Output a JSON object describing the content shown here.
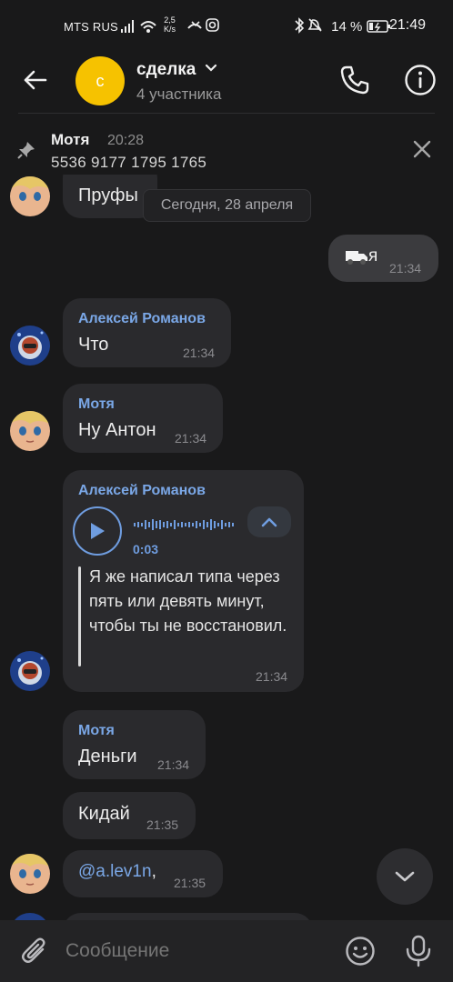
{
  "status_bar": {
    "carrier": "MTS RUS",
    "net_speed_value": "2,5",
    "net_speed_unit": "K/s",
    "battery": "14 %",
    "time": "21:49"
  },
  "header": {
    "avatar_letter": "с",
    "title": "сделка",
    "subtitle": "4 участника",
    "avatar_color": "#f6c200",
    "accent": "#7aa7e6"
  },
  "pinned": {
    "author": "Мотя",
    "time": "20:28",
    "text": "5536 9177 1795 1765"
  },
  "date_chip": "Сегодня, 28 апреля",
  "messages": [
    {
      "author": "",
      "text": "Пруфы",
      "time": ""
    },
    {
      "author": "",
      "text": "я",
      "time": "21:34",
      "outgoing": true
    },
    {
      "author": "Алексей Романов",
      "text": "Что",
      "time": "21:34"
    },
    {
      "author": "Мотя",
      "text": "Ну Антон",
      "time": "21:34"
    },
    {
      "author": "Алексей Романов",
      "type": "voice",
      "duration": "0:03",
      "transcript": "Я же написал типа через пять или девять минут, чтобы ты не восстановил.",
      "time": "21:34"
    },
    {
      "author": "Мотя",
      "text": "Деньги",
      "time": "21:34"
    },
    {
      "author": "",
      "text": "Кидай",
      "time": "21:35"
    },
    {
      "author": "",
      "mention": "@a.lev1n",
      "text": ",",
      "time": "21:35"
    }
  ],
  "input": {
    "placeholder": "Сообщение"
  },
  "icons": [
    "back-arrow-icon",
    "phone-icon",
    "info-icon",
    "pin-icon",
    "close-icon",
    "play-icon",
    "chevron-up-icon",
    "chevron-down-icon",
    "attach-icon",
    "emoji-icon",
    "mic-icon"
  ]
}
